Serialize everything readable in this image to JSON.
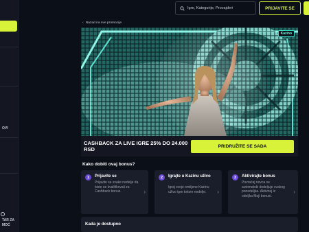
{
  "colors": {
    "accent": "#d8f23a",
    "background": "#0b0f17",
    "card": "#1a1e2a",
    "step_badge": "#6c4bd8",
    "kazino_badge": "#3ad8c8"
  },
  "sidebar": {
    "fragments": [
      "OVI",
      "TAR ZA",
      "MOĆ"
    ]
  },
  "header": {
    "search_placeholder": "Igre, Kategorije, Provajderi",
    "login_label": "PRIJAVITE SE"
  },
  "back_link": "Nazad na sve promocije",
  "hero": {
    "badge": "Kazino"
  },
  "promo": {
    "title": "CASHBACK ZA LIVE IGRE 25% DO 24.000 RSD",
    "cta": "PRIDRUŽITE SE SADA"
  },
  "how_to": {
    "title": "Kako dobiti ovaj bonus?",
    "steps": [
      {
        "number": "1",
        "title": "Prijavite se",
        "description": "Prijavite se svake nedelje da biste se kvalifikovali za Cashback bonus."
      },
      {
        "number": "2",
        "title": "Igrajte u Kazinu uživo",
        "description": "Igraj svoje omiljene Kazinu uživo igre tokom nedelje."
      },
      {
        "number": "3",
        "title": "Aktivirajte bonus",
        "description": "Povraćaj novca se automatski dodeljuje svakog ponedeljka. Aktiviraj iz odeljka Moji bonusi."
      }
    ]
  },
  "availability_title": "Kada je dostupno"
}
